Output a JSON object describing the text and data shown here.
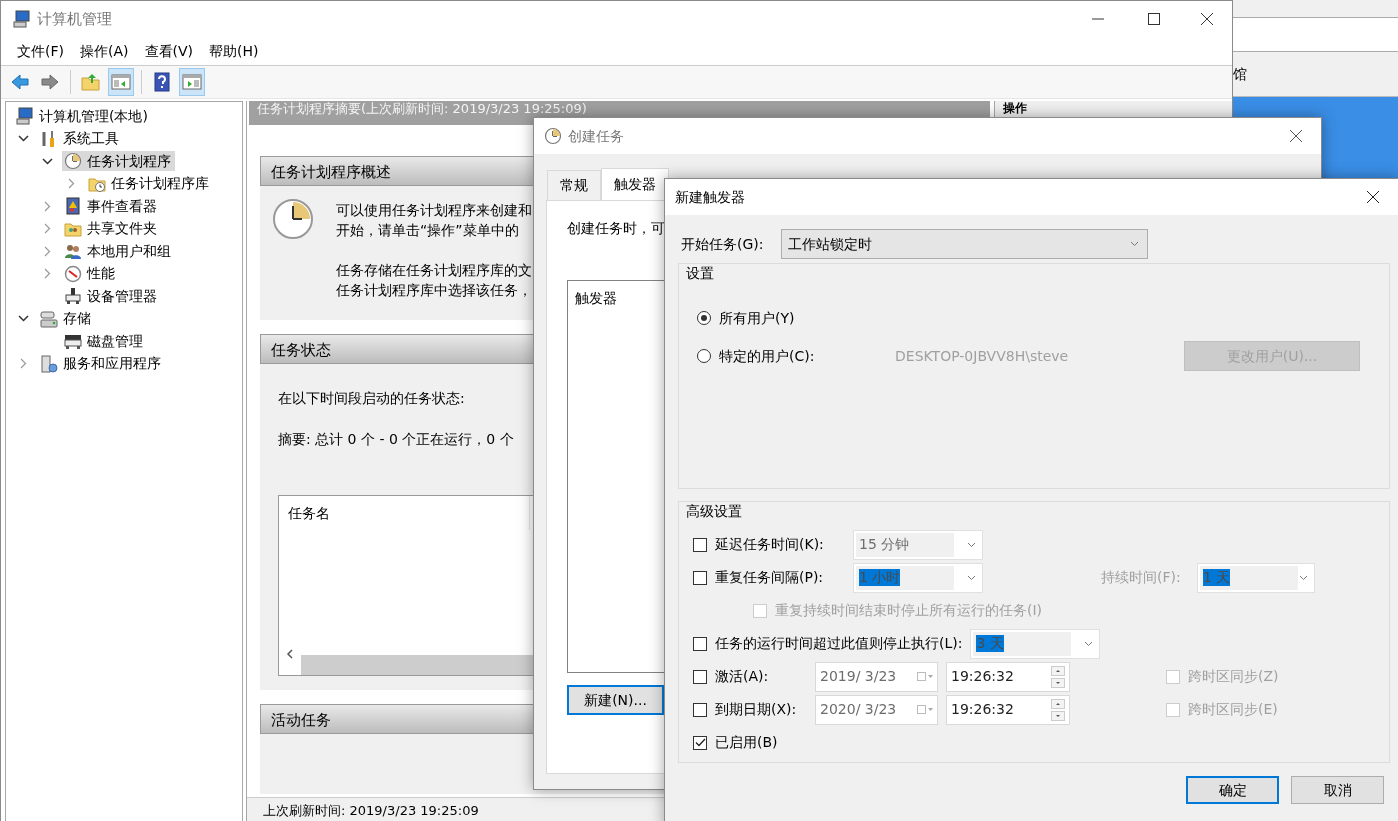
{
  "main_window": {
    "title": "计算机管理",
    "menu": [
      "文件(F)",
      "操作(A)",
      "查看(V)",
      "帮助(H)"
    ],
    "toolbar": [
      [
        {
          "kind": "back",
          "pressed": false
        },
        {
          "kind": "forward",
          "pressed": false
        }
      ],
      [
        {
          "kind": "up",
          "pressed": false
        },
        {
          "kind": "tree_panel",
          "pressed": true
        }
      ],
      [
        {
          "kind": "help",
          "pressed": false
        },
        {
          "kind": "action_panel",
          "pressed": true
        }
      ]
    ],
    "tree": [
      {
        "label": "计算机管理(本地)",
        "kind": "computer",
        "selected": false,
        "children": [
          {
            "label": "系统工具",
            "kind": "tools",
            "expanded": true,
            "selected": false,
            "children": [
              {
                "label": "任务计划程序",
                "kind": "clock",
                "expanded": true,
                "selected": true,
                "children": [
                  {
                    "label": "任务计划程序库",
                    "kind": "folder",
                    "expanded": false,
                    "selected": false
                  }
                ]
              },
              {
                "label": "事件查看器",
                "kind": "log",
                "expanded": false,
                "selected": false
              },
              {
                "label": "共享文件夹",
                "kind": "share",
                "expanded": false,
                "selected": false
              },
              {
                "label": "本地用户和组",
                "kind": "users",
                "expanded": false,
                "selected": false
              },
              {
                "label": "性能",
                "kind": "gauge",
                "expanded": false,
                "selected": false
              },
              {
                "label": "设备管理器",
                "kind": "device",
                "selected": false
              }
            ]
          },
          {
            "label": "存储",
            "kind": "storage",
            "expanded": true,
            "selected": false,
            "children": [
              {
                "label": "磁盘管理",
                "kind": "disk",
                "selected": false
              }
            ]
          },
          {
            "label": "服务和应用程序",
            "kind": "server",
            "expanded": false,
            "selected": false
          }
        ]
      }
    ],
    "summary_header": "任务计划程序摘要(上次刷新时间: 2019/3/23 19:25:09)",
    "sections": [
      {
        "kind": "overview",
        "title": "任务计划程序概述",
        "paragraphs": [
          [
            "可以使用任务计划程序来创建和",
            "开始，请单击“操作”菜单中的"
          ],
          [
            "任务存储在任务计划程序库的文",
            "任务计划程序库中选择该任务，"
          ]
        ]
      },
      {
        "kind": "status",
        "title": "任务状态",
        "lines": [
          "在以下时间段启动的任务状态:",
          "摘要: 总计 0 个 - 0 个正在运行，0 个"
        ],
        "table": {
          "columns": [
            "任务名"
          ]
        }
      },
      {
        "kind": "active",
        "title": "活动任务"
      }
    ],
    "status_bar": "上次刷新时间: 2019/3/23 19:25:09",
    "actions_pane": {
      "title": "操作"
    }
  },
  "background_window": {
    "text": "馆"
  },
  "create_task_dialog": {
    "title": "创建任务",
    "tabs": [
      {
        "label": "常规",
        "selected": false
      },
      {
        "label": "触发器",
        "selected": true
      }
    ],
    "intro": "创建任务时，可",
    "trigger_list": {
      "columns": [
        "触发器"
      ]
    },
    "new_button": "新建(N)..."
  },
  "new_trigger_dialog": {
    "title": "新建触发器",
    "begin": {
      "label": "开始任务(G):",
      "value": "工作站锁定时"
    },
    "settings": {
      "title": "设置",
      "options": [
        {
          "label": "所有用户(Y)",
          "selected": true
        },
        {
          "label": "特定的用户(C):",
          "selected": false,
          "user": "DESKTOP-0JBVV8H\\steve",
          "button": {
            "label": "更改用户(U)...",
            "disabled": true
          }
        }
      ]
    },
    "advanced": {
      "title": "高级设置",
      "rows": [
        {
          "kind": "dropdown",
          "label": "延迟任务时间(K):",
          "checked": false,
          "disabled": false,
          "value": {
            "text": "15 分钟",
            "highlighted": false
          }
        },
        {
          "kind": "dropdown",
          "label": "重复任务间隔(P):",
          "checked": false,
          "disabled": false,
          "value": {
            "text": "1 小时",
            "highlighted": true
          },
          "extra": {
            "label": "持续时间(F):",
            "value": {
              "text": "1 天",
              "highlighted": true
            }
          }
        },
        {
          "kind": "subcheck",
          "label": "重复持续时间结束时停止所有运行的任务(I)",
          "checked": false,
          "disabled": true
        },
        {
          "kind": "dropdown",
          "label": "任务的运行时间超过此值则停止执行(L):",
          "checked": false,
          "disabled": false,
          "value": {
            "text": "3 天",
            "highlighted": true
          }
        },
        {
          "kind": "datetime",
          "label": "激活(A):",
          "checked": false,
          "disabled": false,
          "date": "2019/ 3/23",
          "time": "19:26:32",
          "sync": {
            "label": "跨时区同步(Z)",
            "checked": false,
            "disabled": true
          }
        },
        {
          "kind": "datetime",
          "label": "到期日期(X):",
          "checked": false,
          "disabled": false,
          "date": "2020/ 3/23",
          "time": "19:26:32",
          "sync": {
            "label": "跨时区同步(E)",
            "checked": false,
            "disabled": true
          }
        },
        {
          "kind": "check",
          "label": "已启用(B)",
          "checked": true,
          "disabled": false
        }
      ]
    },
    "buttons": [
      {
        "label": "确定",
        "default": true
      },
      {
        "label": "取消",
        "default": false
      }
    ]
  }
}
